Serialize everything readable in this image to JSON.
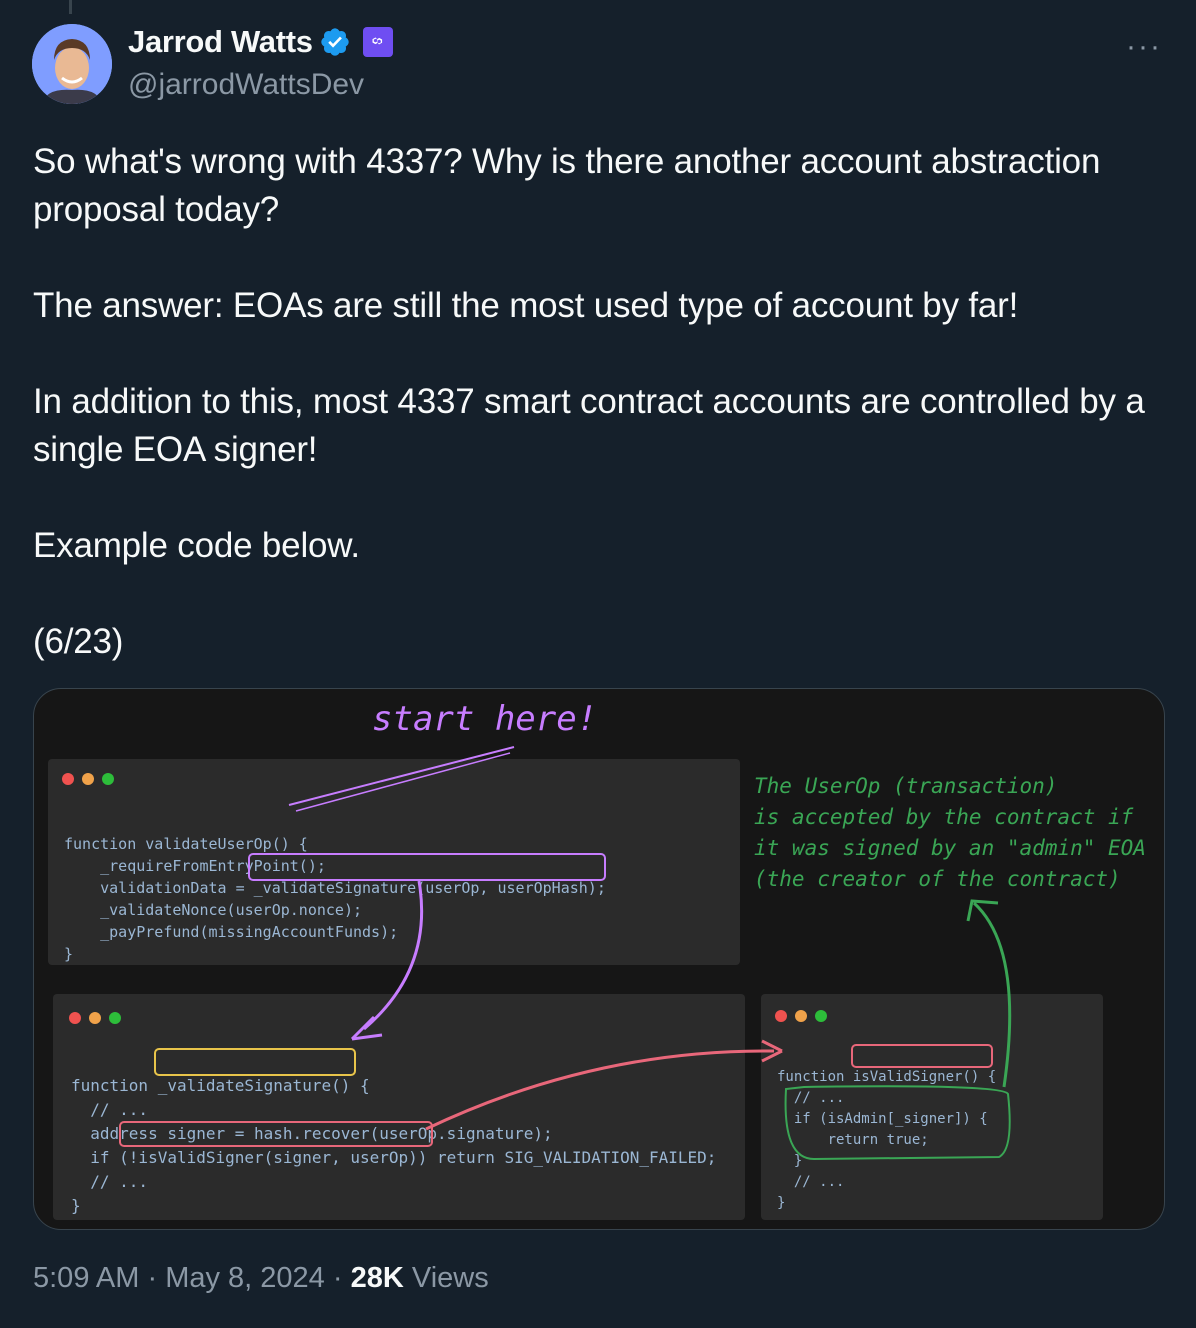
{
  "author": {
    "name": "Jarrod Watts",
    "handle": "@jarrodWattsDev"
  },
  "icons": {
    "avatar": "profile-photo",
    "verified": "verified-badge-icon",
    "affiliation": "polygon-affiliate-icon",
    "more": "more-options-icon"
  },
  "more_label": "···",
  "tweet": {
    "paragraphs": [
      "So what's wrong with 4337? Why is there another account abstraction proposal today?",
      "The answer: EOAs are still the most used type of account by far!",
      "In addition to this, most 4337 smart contract accounts are controlled by a single EOA signer!",
      "Example code below.",
      "(6/23)"
    ]
  },
  "image": {
    "start_note": "start here!",
    "note_lines": [
      "The UserOp (transaction)",
      "is accepted by the contract if",
      "it was signed by an \"admin\" EOA",
      "(the creator of the contract)"
    ],
    "code1": [
      "function validateUserOp() {",
      "    _requireFromEntryPoint();",
      "    validationData = _validateSignature(userOp, userOpHash);",
      "    _validateNonce(userOp.nonce);",
      "    _payPrefund(missingAccountFunds);",
      "}"
    ],
    "code2": [
      "function _validateSignature() {",
      "  // ...",
      "  address signer = hash.recover(userOp.signature);",
      "  if (!isValidSigner(signer, userOp)) return SIG_VALIDATION_FAILED;",
      "  // ...",
      "}"
    ],
    "code3": [
      "function isValidSigner() {",
      "  // ...",
      "  if (isAdmin[_signer]) {",
      "      return true;",
      "  }",
      "  // ...",
      "}"
    ],
    "colors": {
      "purple": "#c77dff",
      "green": "#3aa655",
      "red": "#e8677a",
      "dot_red": "#f0524f",
      "dot_orange": "#f0a24a",
      "dot_green": "#2dbd3a"
    }
  },
  "footer": {
    "time": "5:09 AM",
    "sep": "·",
    "date": "May 8, 2024",
    "views_count": "28K",
    "views_label": "Views"
  }
}
